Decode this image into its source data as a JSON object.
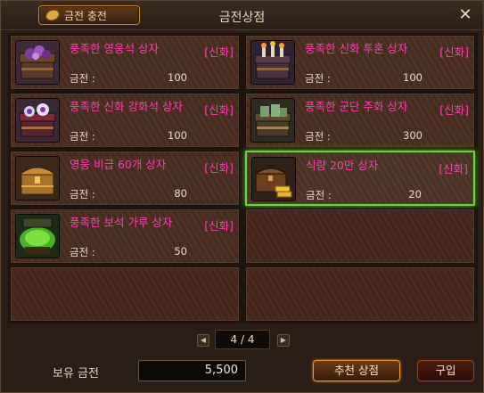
{
  "window": {
    "title": "금전상점",
    "charge_button": "금전 충전",
    "close_glyph": "✕"
  },
  "items": [
    {
      "name": "풍족한 영웅석 상자",
      "grade": "[신화]",
      "price_label": "금전 :",
      "price": "100",
      "icon": "purple-gem-chest-icon",
      "selected": false
    },
    {
      "name": "풍족한 신화 투혼 상자",
      "grade": "[신화]",
      "price_label": "금전 :",
      "price": "100",
      "icon": "candle-chest-icon",
      "selected": false
    },
    {
      "name": "풍족한 신화 강화석 상자",
      "grade": "[신화]",
      "price_label": "금전 :",
      "price": "100",
      "icon": "orb-chest-icon",
      "selected": false
    },
    {
      "name": "풍족한 군단 주화 상자",
      "grade": "[신화]",
      "price_label": "금전 :",
      "price": "300",
      "icon": "coin-stack-chest-icon",
      "selected": false
    },
    {
      "name": "영웅 비급 60개 상자",
      "grade": "[신화]",
      "price_label": "금전 :",
      "price": "80",
      "icon": "golden-chest-icon",
      "selected": false
    },
    {
      "name": "식량 20만 상자",
      "grade": "[신화]",
      "price_label": "금전 :",
      "price": "20",
      "icon": "gold-bar-chest-icon",
      "selected": true
    },
    {
      "name": "풍족한 보석 가루 상자",
      "grade": "[신화]",
      "price_label": "금전 :",
      "price": "50",
      "icon": "green-dust-chest-icon",
      "selected": false
    }
  ],
  "pager": {
    "display": "4 / 4",
    "prev_glyph": "◀",
    "next_glyph": "▶"
  },
  "footer": {
    "balance_label": "보유 금전",
    "balance_value": "5,500",
    "recommend_button": "추천 상점",
    "buy_button": "구입"
  },
  "colors": {
    "grade_text": "#ff3fb4",
    "selected_border": "#6fd240",
    "panel_bg": "#4a2f21"
  }
}
